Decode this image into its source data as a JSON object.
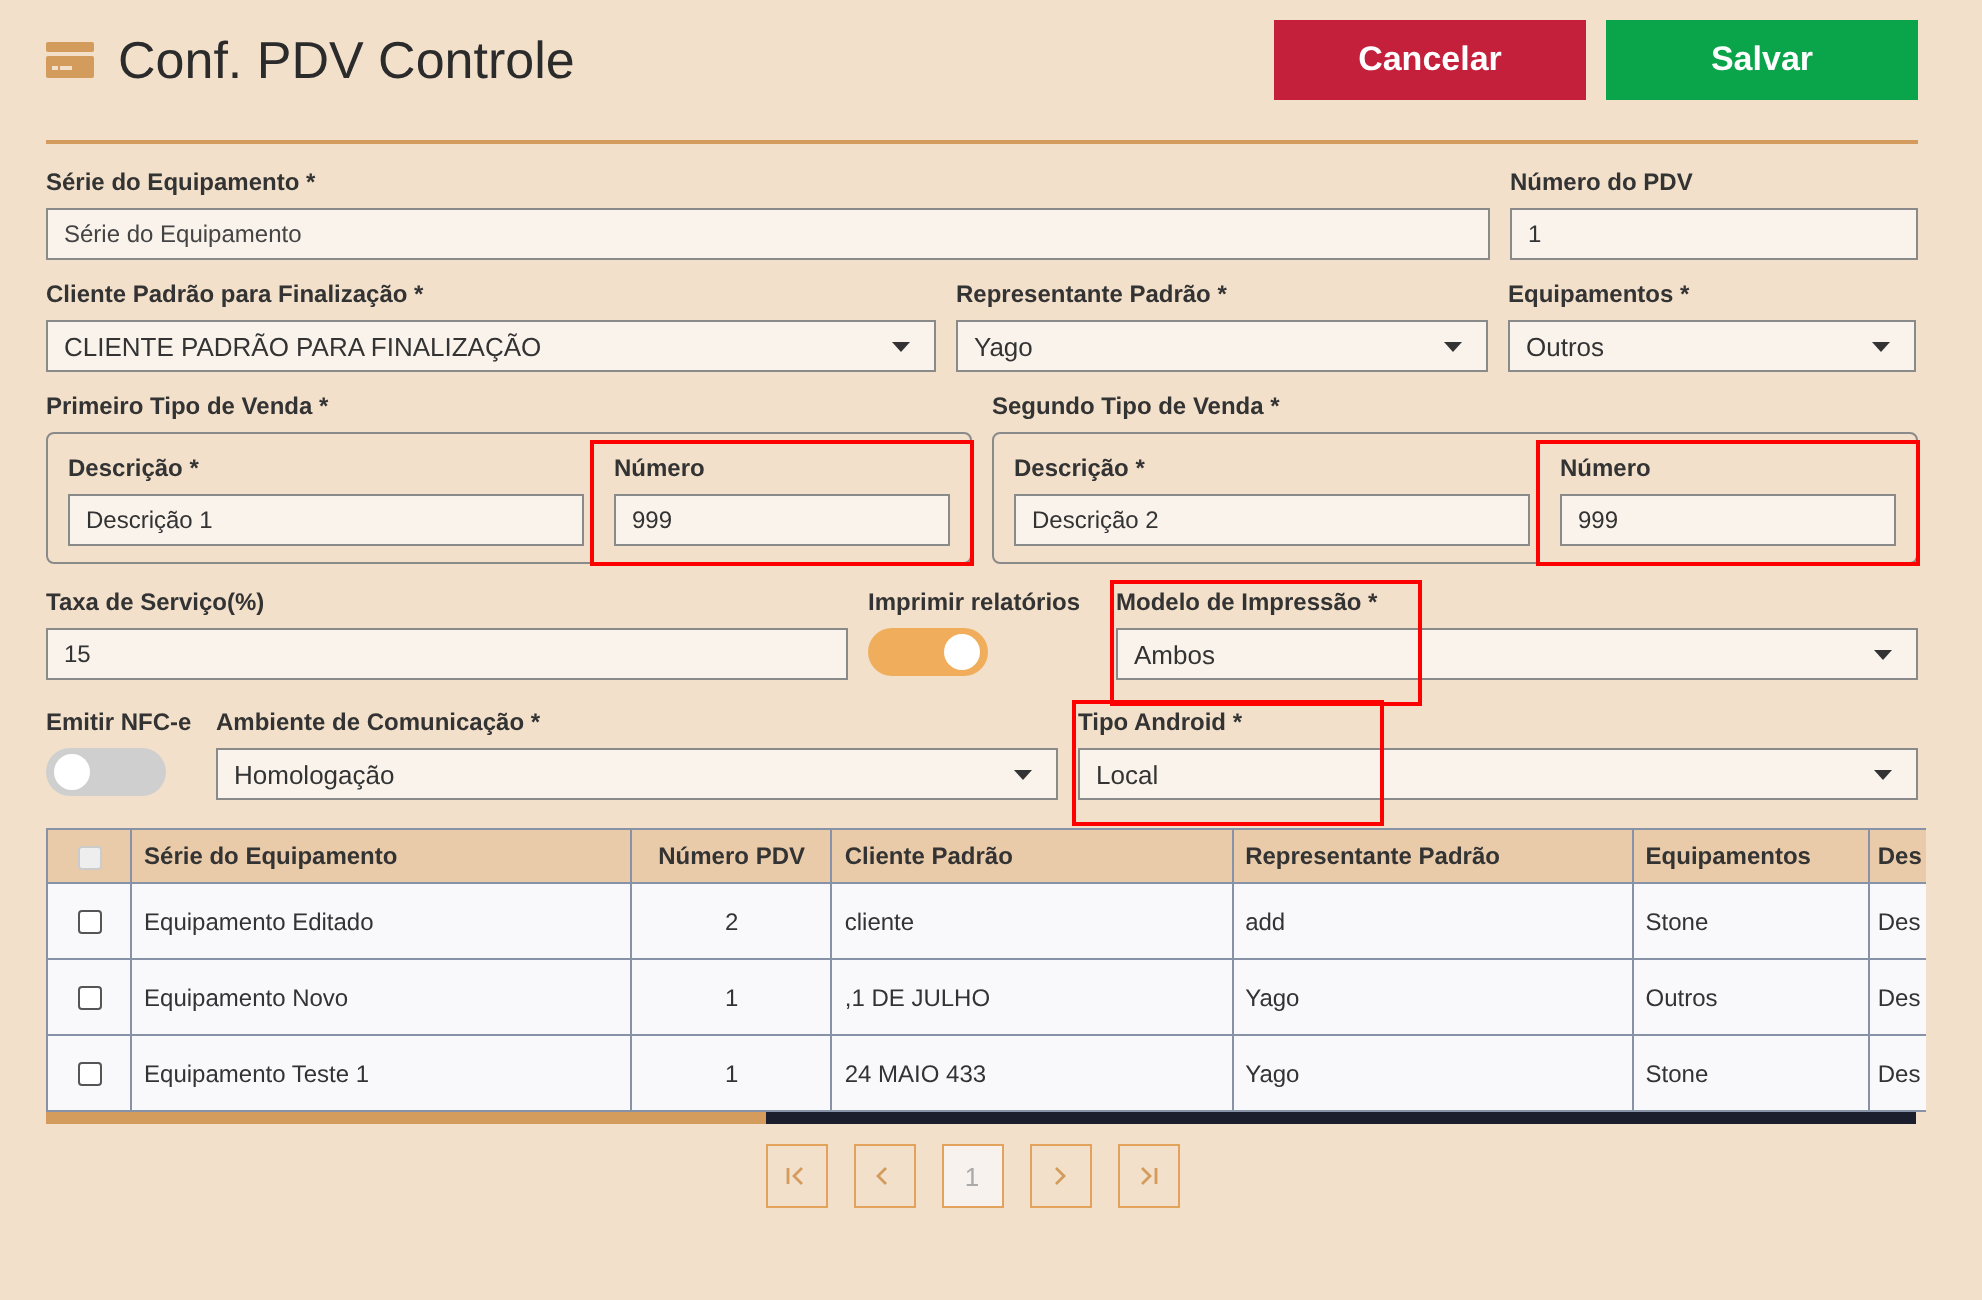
{
  "header": {
    "title": "Conf. PDV Controle",
    "buttons": [
      {
        "label": "Cancelar",
        "kind": "danger"
      },
      {
        "label": "Salvar",
        "kind": "success"
      }
    ]
  },
  "form": {
    "row1": [
      {
        "label": "Série do Equipamento *",
        "kind": "text",
        "placeholder": "Série do Equipamento",
        "highlighted": false
      },
      {
        "label": "Número do PDV",
        "kind": "text",
        "value": "1",
        "highlighted": false
      }
    ],
    "row2": [
      {
        "label": "Cliente Padrão para Finalização *",
        "kind": "select",
        "value": "CLIENTE PADRÃO PARA FINALIZAÇÃO",
        "highlighted": false
      },
      {
        "label": "Representante Padrão *",
        "kind": "select",
        "value": "Yago",
        "highlighted": false
      },
      {
        "label": "Equipamentos *",
        "kind": "select",
        "value": "Outros",
        "highlighted": false
      }
    ],
    "sale_types": [
      {
        "title": "Primeiro Tipo de Venda *",
        "fields": [
          {
            "label": "Descrição *",
            "kind": "text",
            "value": "Descrição 1",
            "highlighted": false
          },
          {
            "label": "Número",
            "kind": "text",
            "value": "999",
            "highlighted": true
          }
        ]
      },
      {
        "title": "Segundo Tipo de Venda *",
        "fields": [
          {
            "label": "Descrição *",
            "kind": "text",
            "value": "Descrição 2",
            "highlighted": false
          },
          {
            "label": "Número",
            "kind": "text",
            "value": "999",
            "highlighted": true
          }
        ]
      }
    ],
    "row4": [
      {
        "label": "Taxa de Serviço(%)",
        "kind": "text",
        "value": "15",
        "highlighted": false
      },
      {
        "label": "Imprimir relatórios",
        "kind": "toggle",
        "on": true,
        "highlighted": false
      },
      {
        "label": "Modelo de Impressão *",
        "kind": "select",
        "value": "Ambos",
        "highlighted": true
      }
    ],
    "row5": [
      {
        "label": "Emitir NFC-e",
        "kind": "toggle",
        "on": false,
        "highlighted": false
      },
      {
        "label": "Ambiente de Comunicação *",
        "kind": "select",
        "value": "Homologação",
        "highlighted": false
      },
      {
        "label": "Tipo Android *",
        "kind": "select",
        "value": "Local",
        "highlighted": true
      }
    ]
  },
  "table": {
    "header_checkbox": {
      "checked": false
    },
    "columns": [
      "Série do Equipamento",
      "Número PDV",
      "Cliente Padrão",
      "Representante Padrão",
      "Equipamentos",
      "Des"
    ],
    "rows": [
      {
        "checked": false,
        "cells": [
          "Equipamento Editado",
          "2",
          "cliente",
          "add",
          "Stone",
          "Des"
        ]
      },
      {
        "checked": false,
        "cells": [
          "Equipamento Novo",
          "1",
          ",1 DE JULHO",
          "Yago",
          "Outros",
          "Des"
        ]
      },
      {
        "checked": false,
        "cells": [
          "Equipamento Teste 1",
          "1",
          "24 MAIO 433",
          "Yago",
          "Stone",
          "Des"
        ]
      }
    ]
  },
  "pagination": {
    "pages": [
      {
        "label": "1",
        "selected": true
      }
    ]
  }
}
